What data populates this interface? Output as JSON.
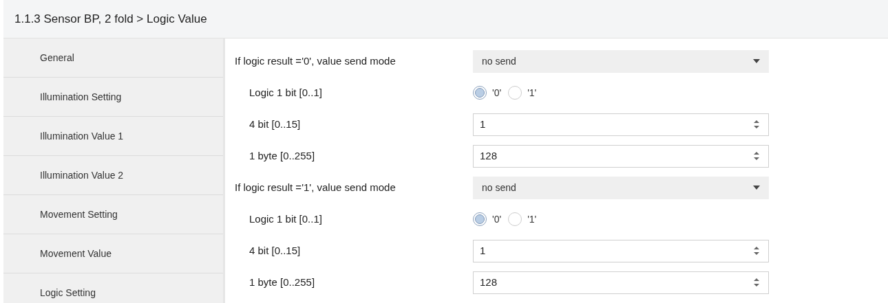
{
  "header": {
    "title": "1.1.3 Sensor BP, 2 fold > Logic Value"
  },
  "sidebar": {
    "items": [
      {
        "label": "General",
        "selected": false
      },
      {
        "label": "Illumination Setting",
        "selected": false
      },
      {
        "label": "Illumination Value 1",
        "selected": false
      },
      {
        "label": "Illumination Value 2",
        "selected": false
      },
      {
        "label": "Movement Setting",
        "selected": false
      },
      {
        "label": "Movement Value",
        "selected": false
      },
      {
        "label": "Logic Setting",
        "selected": false
      }
    ]
  },
  "params": [
    {
      "kind": "select",
      "label": "If logic result ='0', value send mode",
      "value": "no send"
    },
    {
      "kind": "radio",
      "label": "Logic 1 bit [0..1]",
      "options": [
        {
          "label": "'0'",
          "selected": true
        },
        {
          "label": "'1'",
          "selected": false
        }
      ]
    },
    {
      "kind": "spin",
      "label": "4 bit [0..15]",
      "value": "1"
    },
    {
      "kind": "spin",
      "label": "1 byte [0..255]",
      "value": "128"
    },
    {
      "kind": "select",
      "label": "If logic result ='1', value send mode",
      "value": "no send"
    },
    {
      "kind": "radio",
      "label": "Logic 1 bit [0..1]",
      "options": [
        {
          "label": "'0'",
          "selected": true
        },
        {
          "label": "'1'",
          "selected": false
        }
      ]
    },
    {
      "kind": "spin",
      "label": "4 bit [0..15]",
      "value": "1"
    },
    {
      "kind": "spin",
      "label": "1 byte [0..255]",
      "value": "128"
    }
  ]
}
